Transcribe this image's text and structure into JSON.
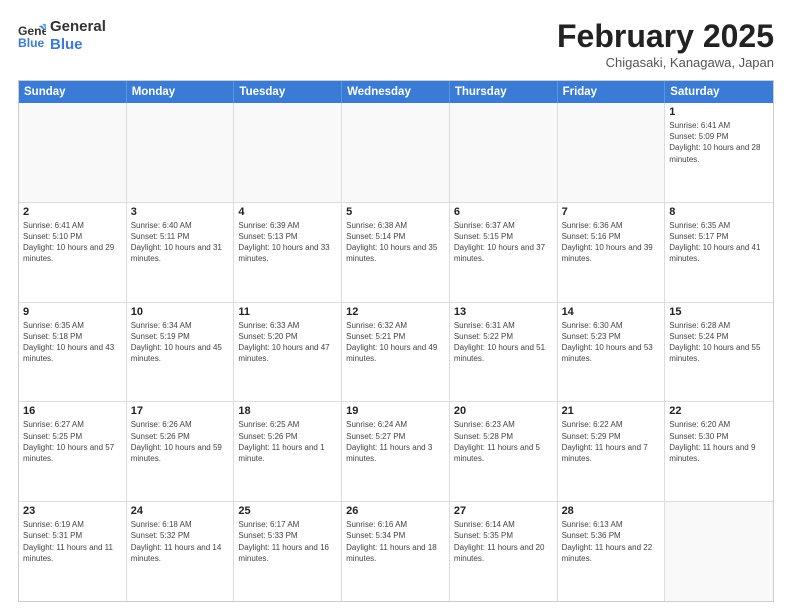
{
  "header": {
    "logo_line1": "General",
    "logo_line2": "Blue",
    "title": "February 2025",
    "subtitle": "Chigasaki, Kanagawa, Japan"
  },
  "days_of_week": [
    "Sunday",
    "Monday",
    "Tuesday",
    "Wednesday",
    "Thursday",
    "Friday",
    "Saturday"
  ],
  "weeks": [
    [
      {
        "day": "",
        "info": ""
      },
      {
        "day": "",
        "info": ""
      },
      {
        "day": "",
        "info": ""
      },
      {
        "day": "",
        "info": ""
      },
      {
        "day": "",
        "info": ""
      },
      {
        "day": "",
        "info": ""
      },
      {
        "day": "1",
        "info": "Sunrise: 6:41 AM\nSunset: 5:09 PM\nDaylight: 10 hours and 28 minutes."
      }
    ],
    [
      {
        "day": "2",
        "info": "Sunrise: 6:41 AM\nSunset: 5:10 PM\nDaylight: 10 hours and 29 minutes."
      },
      {
        "day": "3",
        "info": "Sunrise: 6:40 AM\nSunset: 5:11 PM\nDaylight: 10 hours and 31 minutes."
      },
      {
        "day": "4",
        "info": "Sunrise: 6:39 AM\nSunset: 5:13 PM\nDaylight: 10 hours and 33 minutes."
      },
      {
        "day": "5",
        "info": "Sunrise: 6:38 AM\nSunset: 5:14 PM\nDaylight: 10 hours and 35 minutes."
      },
      {
        "day": "6",
        "info": "Sunrise: 6:37 AM\nSunset: 5:15 PM\nDaylight: 10 hours and 37 minutes."
      },
      {
        "day": "7",
        "info": "Sunrise: 6:36 AM\nSunset: 5:16 PM\nDaylight: 10 hours and 39 minutes."
      },
      {
        "day": "8",
        "info": "Sunrise: 6:35 AM\nSunset: 5:17 PM\nDaylight: 10 hours and 41 minutes."
      }
    ],
    [
      {
        "day": "9",
        "info": "Sunrise: 6:35 AM\nSunset: 5:18 PM\nDaylight: 10 hours and 43 minutes."
      },
      {
        "day": "10",
        "info": "Sunrise: 6:34 AM\nSunset: 5:19 PM\nDaylight: 10 hours and 45 minutes."
      },
      {
        "day": "11",
        "info": "Sunrise: 6:33 AM\nSunset: 5:20 PM\nDaylight: 10 hours and 47 minutes."
      },
      {
        "day": "12",
        "info": "Sunrise: 6:32 AM\nSunset: 5:21 PM\nDaylight: 10 hours and 49 minutes."
      },
      {
        "day": "13",
        "info": "Sunrise: 6:31 AM\nSunset: 5:22 PM\nDaylight: 10 hours and 51 minutes."
      },
      {
        "day": "14",
        "info": "Sunrise: 6:30 AM\nSunset: 5:23 PM\nDaylight: 10 hours and 53 minutes."
      },
      {
        "day": "15",
        "info": "Sunrise: 6:28 AM\nSunset: 5:24 PM\nDaylight: 10 hours and 55 minutes."
      }
    ],
    [
      {
        "day": "16",
        "info": "Sunrise: 6:27 AM\nSunset: 5:25 PM\nDaylight: 10 hours and 57 minutes."
      },
      {
        "day": "17",
        "info": "Sunrise: 6:26 AM\nSunset: 5:26 PM\nDaylight: 10 hours and 59 minutes."
      },
      {
        "day": "18",
        "info": "Sunrise: 6:25 AM\nSunset: 5:26 PM\nDaylight: 11 hours and 1 minute."
      },
      {
        "day": "19",
        "info": "Sunrise: 6:24 AM\nSunset: 5:27 PM\nDaylight: 11 hours and 3 minutes."
      },
      {
        "day": "20",
        "info": "Sunrise: 6:23 AM\nSunset: 5:28 PM\nDaylight: 11 hours and 5 minutes."
      },
      {
        "day": "21",
        "info": "Sunrise: 6:22 AM\nSunset: 5:29 PM\nDaylight: 11 hours and 7 minutes."
      },
      {
        "day": "22",
        "info": "Sunrise: 6:20 AM\nSunset: 5:30 PM\nDaylight: 11 hours and 9 minutes."
      }
    ],
    [
      {
        "day": "23",
        "info": "Sunrise: 6:19 AM\nSunset: 5:31 PM\nDaylight: 11 hours and 11 minutes."
      },
      {
        "day": "24",
        "info": "Sunrise: 6:18 AM\nSunset: 5:32 PM\nDaylight: 11 hours and 14 minutes."
      },
      {
        "day": "25",
        "info": "Sunrise: 6:17 AM\nSunset: 5:33 PM\nDaylight: 11 hours and 16 minutes."
      },
      {
        "day": "26",
        "info": "Sunrise: 6:16 AM\nSunset: 5:34 PM\nDaylight: 11 hours and 18 minutes."
      },
      {
        "day": "27",
        "info": "Sunrise: 6:14 AM\nSunset: 5:35 PM\nDaylight: 11 hours and 20 minutes."
      },
      {
        "day": "28",
        "info": "Sunrise: 6:13 AM\nSunset: 5:36 PM\nDaylight: 11 hours and 22 minutes."
      },
      {
        "day": "",
        "info": ""
      }
    ]
  ]
}
